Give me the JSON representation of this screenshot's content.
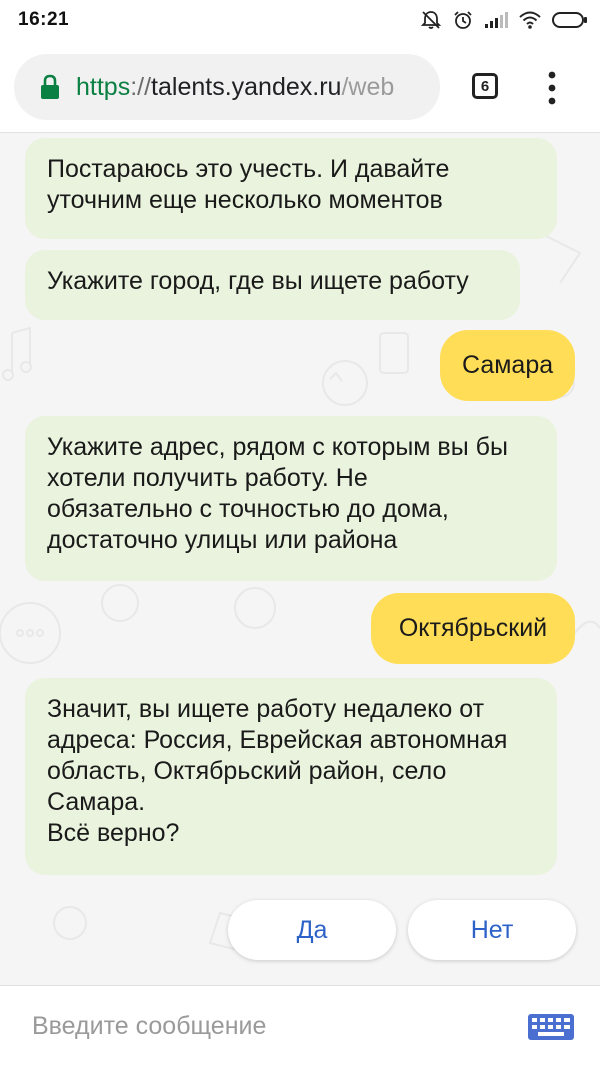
{
  "status_bar": {
    "time": "16:21",
    "icons": [
      "mute-notifications-icon",
      "alarm-icon",
      "cell-signal-icon",
      "wifi-icon",
      "battery-icon"
    ]
  },
  "browser": {
    "url_scheme": "https",
    "url_separator": "://",
    "url_host": "talents.yandex.ru",
    "url_path": "/web",
    "tab_count": "6",
    "icons": [
      "lock-icon",
      "more-vert-icon"
    ],
    "colors": {
      "secure": "#0b8043"
    }
  },
  "chat": {
    "messages": [
      {
        "from": "bot",
        "text": "Постараюсь это учесть. И давайте\nуточним еще несколько моментов"
      },
      {
        "from": "bot",
        "text": "Укажите город, где вы ищете работу"
      },
      {
        "from": "user",
        "text": "Самара"
      },
      {
        "from": "bot",
        "text": "Укажите адрес, рядом с которым вы бы\nхотели получить работу. Не\nобязательно с точностью до дома,\nдостаточно улицы или района"
      },
      {
        "from": "user",
        "text": "Октябрьский"
      },
      {
        "from": "bot",
        "text": "Значит, вы ищете работу недалеко от\nадреса: Россия, Еврейская автономная\nобласть, Октябрьский район, село\nСамара.\nВсё верно?"
      }
    ],
    "quick_replies": [
      "Да",
      "Нет"
    ],
    "colors": {
      "bot_bubble": "#e9f3dd",
      "user_bubble": "#ffdd57",
      "quick_reply_text": "#2d62c9"
    }
  },
  "input": {
    "placeholder": "Введите сообщение",
    "value": "",
    "icon": "keyboard-icon"
  }
}
